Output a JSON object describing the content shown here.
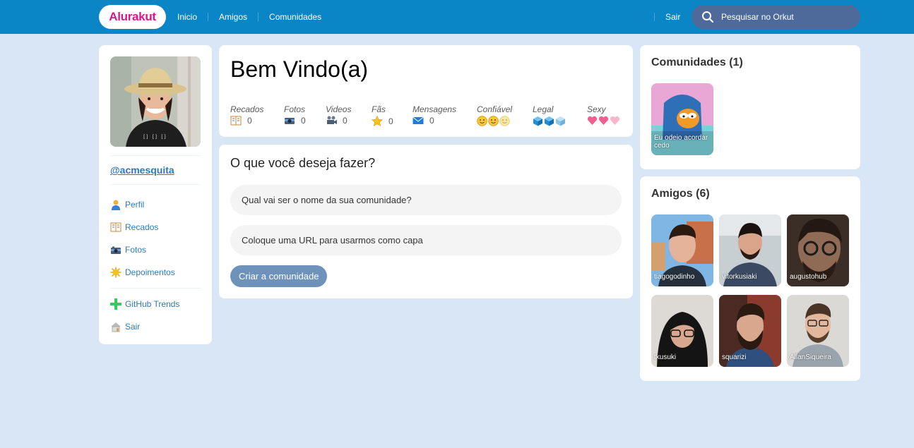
{
  "header": {
    "logo": "Alurakut",
    "nav": [
      "Inicio",
      "Amigos",
      "Comunidades"
    ],
    "logout": "Sair",
    "search_placeholder": "Pesquisar no Orkut"
  },
  "sidebar": {
    "username": "@acmesquita",
    "menu": [
      {
        "label": "Perfil",
        "icon": "user-icon"
      },
      {
        "label": "Recados",
        "icon": "book-icon"
      },
      {
        "label": "Fotos",
        "icon": "camera-icon"
      },
      {
        "label": "Depoimentos",
        "icon": "sun-icon"
      }
    ],
    "menu2": [
      {
        "label": "GitHub Trends",
        "icon": "plus-icon"
      },
      {
        "label": "Sair",
        "icon": "house-icon"
      }
    ]
  },
  "welcome": {
    "title": "Bem Vindo(a)",
    "stats": [
      {
        "label": "Recados",
        "value": "0",
        "icon": "book-icon"
      },
      {
        "label": "Fotos",
        "value": "0",
        "icon": "camera-icon"
      },
      {
        "label": "Videos",
        "value": "0",
        "icon": "video-camera-icon"
      },
      {
        "label": "Fãs",
        "value": "0",
        "icon": "star-icon"
      },
      {
        "label": "Mensagens",
        "value": "0",
        "icon": "envelope-icon"
      }
    ],
    "ratings": [
      {
        "label": "Confiável",
        "icon": "smiley-icon",
        "count": 3
      },
      {
        "label": "Legal",
        "icon": "cube-icon",
        "count": 3
      },
      {
        "label": "Sexy",
        "icon": "heart-icon",
        "count": 3
      }
    ]
  },
  "form": {
    "title": "O que você deseja fazer?",
    "name_placeholder": "Qual vai ser o nome da sua comunidade?",
    "url_placeholder": "Coloque uma URL para usarmos como capa",
    "submit": "Criar a comunidade"
  },
  "communities": {
    "title": "Comunidades (1)",
    "items": [
      "Eu odeio acordar cedo"
    ]
  },
  "friends": {
    "title": "Amigos (6)",
    "items": [
      "tiagogodinho",
      "vitorkusiaki",
      "augustohub",
      "tkusuki",
      "squarizi",
      "AllanSiqueira"
    ]
  },
  "colors": {
    "topbar": "#0a86c7",
    "background": "#d9e6f6",
    "link": "#2e7bb4",
    "logo": "#e0158a",
    "button": "#6f92bb"
  }
}
